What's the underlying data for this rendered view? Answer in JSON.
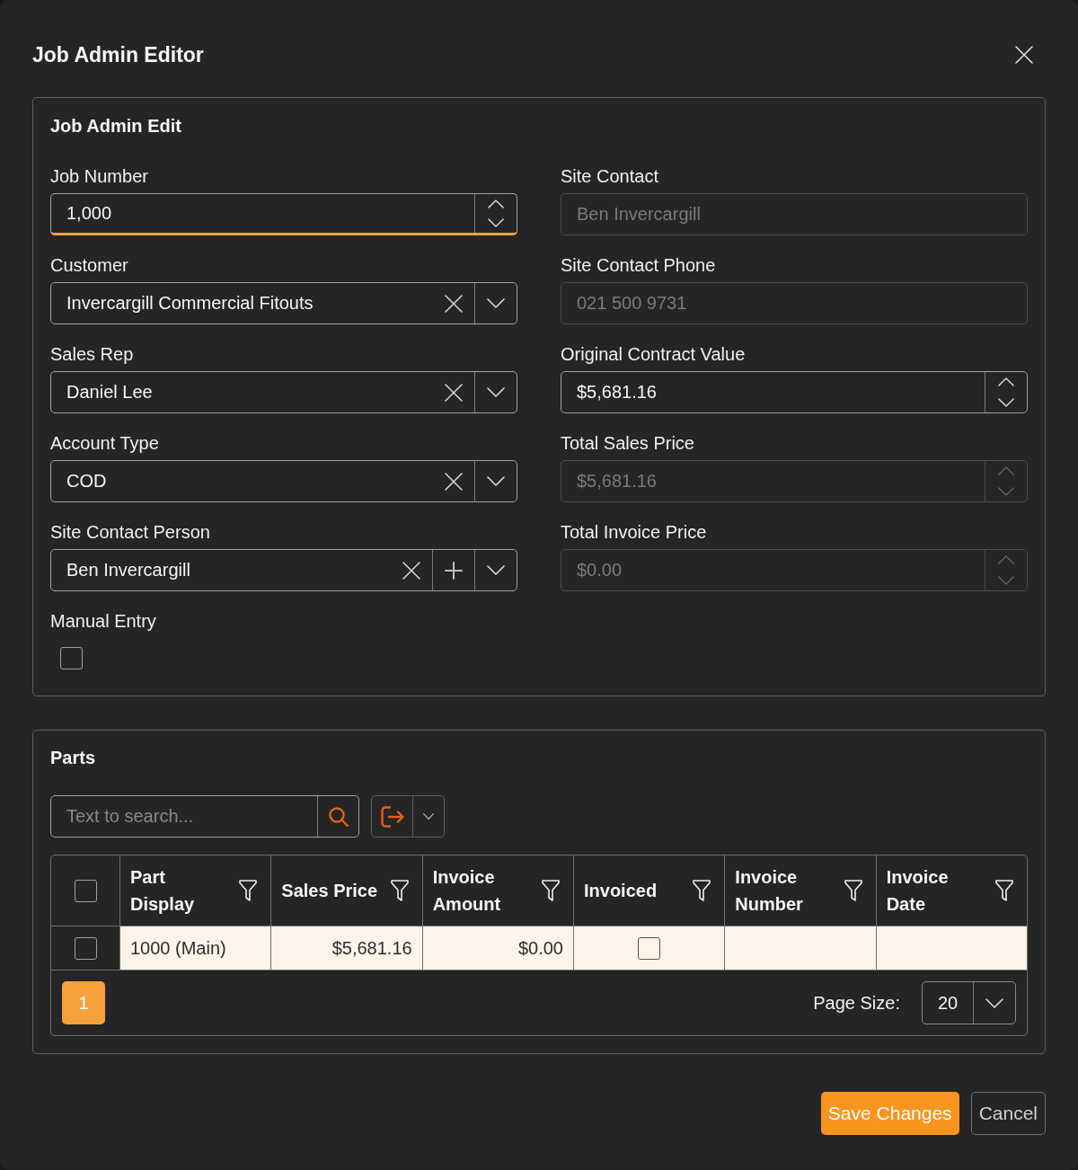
{
  "dialog": {
    "title": "Job Admin Editor"
  },
  "job_admin_edit": {
    "title": "Job Admin Edit",
    "left_fields": [
      {
        "label": "Job Number",
        "kind": "number",
        "value": "1,000",
        "disabled": false,
        "focused": true
      },
      {
        "label": "Customer",
        "kind": "combo",
        "value": "Invercargill Commercial Fitouts",
        "disabled": false,
        "focused": false,
        "add_button": false
      },
      {
        "label": "Sales Rep",
        "kind": "combo",
        "value": "Daniel Lee",
        "disabled": false,
        "focused": false,
        "add_button": false
      },
      {
        "label": "Account Type",
        "kind": "combo",
        "value": "COD",
        "disabled": false,
        "focused": false,
        "add_button": false
      },
      {
        "label": "Site Contact Person",
        "kind": "combo",
        "value": "Ben Invercargill",
        "disabled": false,
        "focused": false,
        "add_button": true
      },
      {
        "label": "Manual Entry",
        "kind": "checkbox",
        "checked": false,
        "disabled": false,
        "focused": false
      }
    ],
    "right_fields": [
      {
        "label": "Site Contact",
        "kind": "text",
        "value": "Ben Invercargill",
        "disabled": true,
        "focused": false
      },
      {
        "label": "Site Contact Phone",
        "kind": "text",
        "value": "021 500 9731",
        "disabled": true,
        "focused": false
      },
      {
        "label": "Original Contract Value",
        "kind": "number",
        "value": "$5,681.16",
        "disabled": false,
        "focused": false
      },
      {
        "label": "Total Sales Price",
        "kind": "number",
        "value": "$5,681.16",
        "disabled": true,
        "focused": false
      },
      {
        "label": "Total Invoice Price",
        "kind": "number",
        "value": "$0.00",
        "disabled": true,
        "focused": false
      }
    ]
  },
  "parts": {
    "title": "Parts",
    "search": {
      "placeholder": "Text to search..."
    },
    "table": {
      "all_selected": false,
      "columns": [
        {
          "label": "Part Display",
          "kind": "text"
        },
        {
          "label": "Sales Price",
          "kind": "money"
        },
        {
          "label": "Invoice Amount",
          "kind": "money"
        },
        {
          "label": "Invoiced",
          "kind": "check"
        },
        {
          "label": "Invoice Number",
          "kind": "text"
        },
        {
          "label": "Invoice Date",
          "kind": "text"
        }
      ],
      "rows": [
        {
          "selected": false,
          "highlighted": true,
          "cells": [
            {
              "text": "1000 (Main)"
            },
            {
              "text": "$5,681.16"
            },
            {
              "text": "$0.00"
            },
            {
              "checked": false
            },
            {},
            {}
          ]
        }
      ]
    },
    "pager": {
      "pages": [
        {
          "label": "1",
          "selected": true
        }
      ],
      "page_size_label": "Page Size:",
      "page_size": "20"
    }
  },
  "buttons": [
    {
      "label": "Save Changes",
      "kind": "primary"
    },
    {
      "label": "Cancel",
      "kind": "secondary"
    }
  ]
}
